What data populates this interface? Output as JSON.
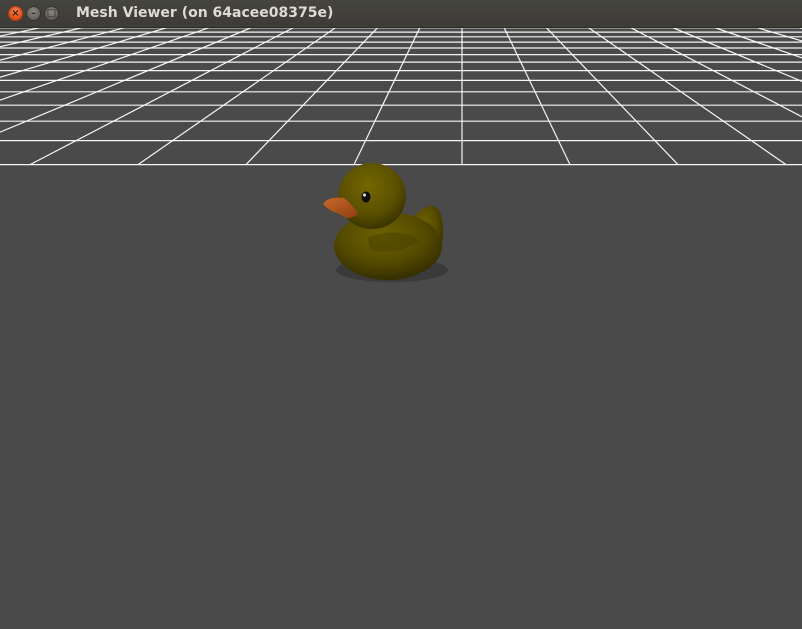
{
  "window": {
    "title": "Mesh Viewer (on 64acee08375e)"
  },
  "icons": {
    "close": "close-icon",
    "minimize": "minimize-icon",
    "maximize": "maximize-icon"
  },
  "scene": {
    "background_color": "#4a4a4a",
    "grid_color": "#ffffff",
    "model": "rubber duck",
    "model_body_color": "#5a4f00",
    "model_beak_color": "#b8551a"
  }
}
